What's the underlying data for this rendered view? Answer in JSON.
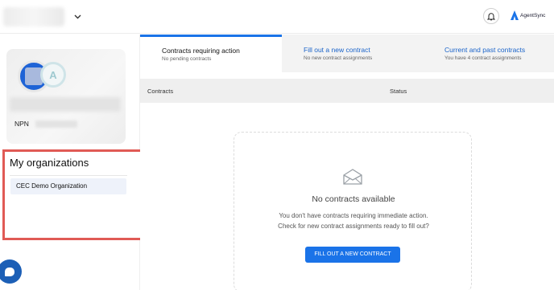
{
  "header": {
    "org_selector_icon": "chevron-down-icon",
    "notification_icon": "bell-icon",
    "brand": {
      "icon": "agentsync-logo",
      "text": "AgentSync",
      "color": "#1a73e8"
    }
  },
  "sidebar": {
    "npn_label": "NPN",
    "organizations_title": "My organizations",
    "organizations": [
      {
        "name": "CEC Demo Organization"
      }
    ],
    "highlight_color": "#e05a55",
    "chat_icon": "chat-bubble-icon"
  },
  "tabs": [
    {
      "title": "Contracts requiring action",
      "subtitle": "No pending contracts",
      "active": true
    },
    {
      "title": "Fill out a new contract",
      "subtitle": "No new contract assignments",
      "active": false
    },
    {
      "title": "Current and past contracts",
      "subtitle": "You have 4 contract assignments",
      "active": false
    }
  ],
  "table": {
    "columns": [
      "Contracts",
      "Status"
    ]
  },
  "empty_state": {
    "icon": "envelope-icon",
    "title": "No contracts available",
    "line1": "You don't have contracts requiring immediate action.",
    "line2": "Check for new contract assignments ready to fill out?",
    "button_label": "FILL OUT A NEW CONTRACT"
  },
  "colors": {
    "accent": "#1a73e8",
    "link": "#1a63c9"
  }
}
